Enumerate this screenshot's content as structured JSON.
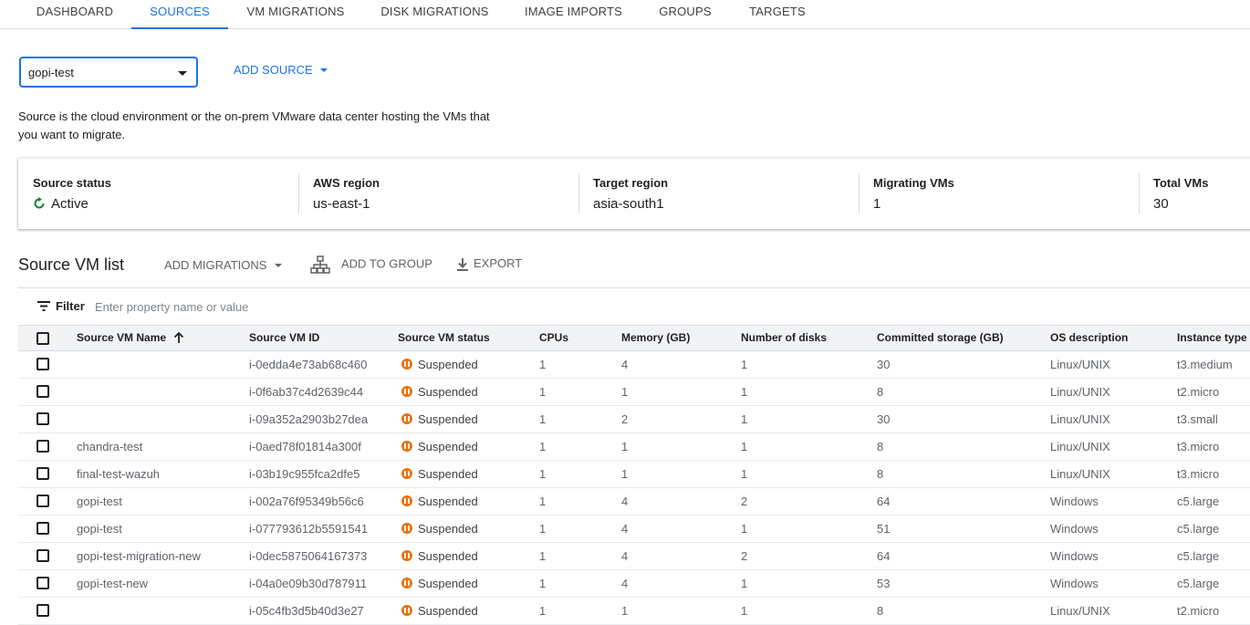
{
  "tabs": [
    {
      "label": "DASHBOARD"
    },
    {
      "label": "SOURCES"
    },
    {
      "label": "VM MIGRATIONS"
    },
    {
      "label": "DISK MIGRATIONS"
    },
    {
      "label": "IMAGE IMPORTS"
    },
    {
      "label": "GROUPS"
    },
    {
      "label": "TARGETS"
    }
  ],
  "active_tab": "SOURCES",
  "source_select": {
    "value": "gopi-test"
  },
  "add_source": {
    "label": "ADD SOURCE"
  },
  "description": "Source is the cloud environment or the on-prem VMware data center hosting the VMs that you want to migrate.",
  "summary": {
    "source_status": {
      "label": "Source status",
      "value": "Active"
    },
    "aws_region": {
      "label": "AWS region",
      "value": "us-east-1"
    },
    "target_region": {
      "label": "Target region",
      "value": "asia-south1"
    },
    "migrating_vms": {
      "label": "Migrating VMs",
      "value": "1"
    },
    "total_vms": {
      "label": "Total VMs",
      "value": "30"
    }
  },
  "vm_list": {
    "title": "Source VM list",
    "add_migrations": "ADD MIGRATIONS",
    "add_to_group": "ADD TO GROUP",
    "export": "EXPORT",
    "filter_label": "Filter",
    "filter_placeholder": "Enter property name or value"
  },
  "table": {
    "columns": [
      "Source VM Name",
      "Source VM ID",
      "Source VM status",
      "CPUs",
      "Memory (GB)",
      "Number of disks",
      "Committed storage (GB)",
      "OS description",
      "Instance type"
    ],
    "rows": [
      {
        "name": "",
        "id": "i-0edda4e73ab68c460",
        "status": "Suspended",
        "cpus": "1",
        "memory": "4",
        "disks": "1",
        "storage": "30",
        "os": "Linux/UNIX",
        "type": "t3.medium"
      },
      {
        "name": "",
        "id": "i-0f6ab37c4d2639c44",
        "status": "Suspended",
        "cpus": "1",
        "memory": "1",
        "disks": "1",
        "storage": "8",
        "os": "Linux/UNIX",
        "type": "t2.micro"
      },
      {
        "name": "",
        "id": "i-09a352a2903b27dea",
        "status": "Suspended",
        "cpus": "1",
        "memory": "2",
        "disks": "1",
        "storage": "30",
        "os": "Linux/UNIX",
        "type": "t3.small"
      },
      {
        "name": "chandra-test",
        "id": "i-0aed78f01814a300f",
        "status": "Suspended",
        "cpus": "1",
        "memory": "1",
        "disks": "1",
        "storage": "8",
        "os": "Linux/UNIX",
        "type": "t3.micro"
      },
      {
        "name": "final-test-wazuh",
        "id": "i-03b19c955fca2dfe5",
        "status": "Suspended",
        "cpus": "1",
        "memory": "1",
        "disks": "1",
        "storage": "8",
        "os": "Linux/UNIX",
        "type": "t3.micro"
      },
      {
        "name": "gopi-test",
        "id": "i-002a76f95349b56c6",
        "status": "Suspended",
        "cpus": "1",
        "memory": "4",
        "disks": "2",
        "storage": "64",
        "os": "Windows",
        "type": "c5.large"
      },
      {
        "name": "gopi-test",
        "id": "i-077793612b5591541",
        "status": "Suspended",
        "cpus": "1",
        "memory": "4",
        "disks": "1",
        "storage": "51",
        "os": "Windows",
        "type": "c5.large"
      },
      {
        "name": "gopi-test-migration-new",
        "id": "i-0dec5875064167373",
        "status": "Suspended",
        "cpus": "1",
        "memory": "4",
        "disks": "2",
        "storage": "64",
        "os": "Windows",
        "type": "c5.large"
      },
      {
        "name": "gopi-test-new",
        "id": "i-04a0e09b30d787911",
        "status": "Suspended",
        "cpus": "1",
        "memory": "4",
        "disks": "1",
        "storage": "53",
        "os": "Windows",
        "type": "c5.large"
      },
      {
        "name": "",
        "id": "i-05c4fb3d5b40d3e27",
        "status": "Suspended",
        "cpus": "1",
        "memory": "1",
        "disks": "1",
        "storage": "8",
        "os": "Linux/UNIX",
        "type": "t2.micro"
      }
    ]
  },
  "colors": {
    "accent": "#1a73e8",
    "active_status": "#188038",
    "suspended_status": "#e8710a"
  },
  "icons": {
    "status_active": "refresh-check-icon",
    "status_suspended": "pause-circle-icon",
    "sort": "arrow-up-icon",
    "group": "hierarchy-icon",
    "export": "download-icon",
    "filter": "filter-lines-icon"
  }
}
